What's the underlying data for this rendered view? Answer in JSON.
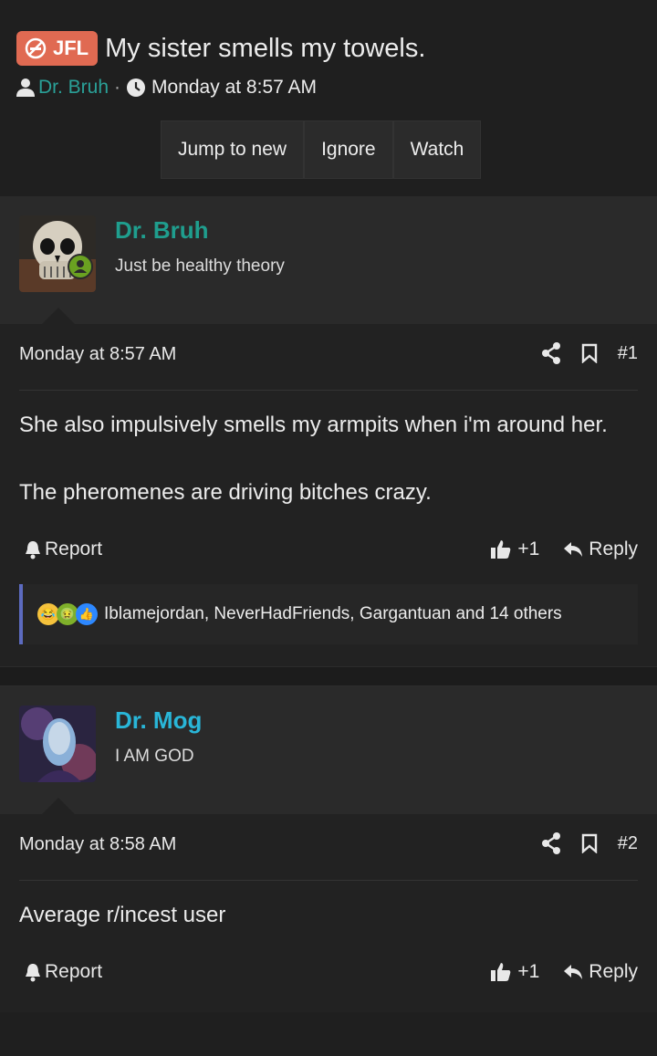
{
  "thread": {
    "prefix": "JFL",
    "title": "My sister smells my towels.",
    "author": "Dr. Bruh",
    "dot": "·",
    "time": "Monday at 8:57 AM"
  },
  "buttons": {
    "jump": "Jump to new",
    "ignore": "Ignore",
    "watch": "Watch"
  },
  "posts": [
    {
      "username": "Dr. Bruh",
      "username_color": "#1f9e8e",
      "user_title": "Just be healthy theory",
      "time": "Monday at 8:57 AM",
      "number": "#1",
      "paragraphs": [
        "She also impulsively smells my armpits when i'm around her.",
        "The pheromenes are driving bitches crazy."
      ],
      "report": "Report",
      "likes": "+1",
      "reply": "Reply",
      "reactions": "Iblamejordan, NeverHadFriends, Gargantuan and 14 others"
    },
    {
      "username": "Dr. Mog",
      "username_color": "#29b6d8",
      "user_title": "I AM GOD",
      "time": "Monday at 8:58 AM",
      "number": "#2",
      "paragraphs": [
        "Average r/incest user"
      ],
      "report": "Report",
      "likes": "+1",
      "reply": "Reply"
    }
  ],
  "colors": {
    "badge": "#e06a52",
    "online": "#6aa121",
    "reaction_bar": "#5c6bc0"
  }
}
